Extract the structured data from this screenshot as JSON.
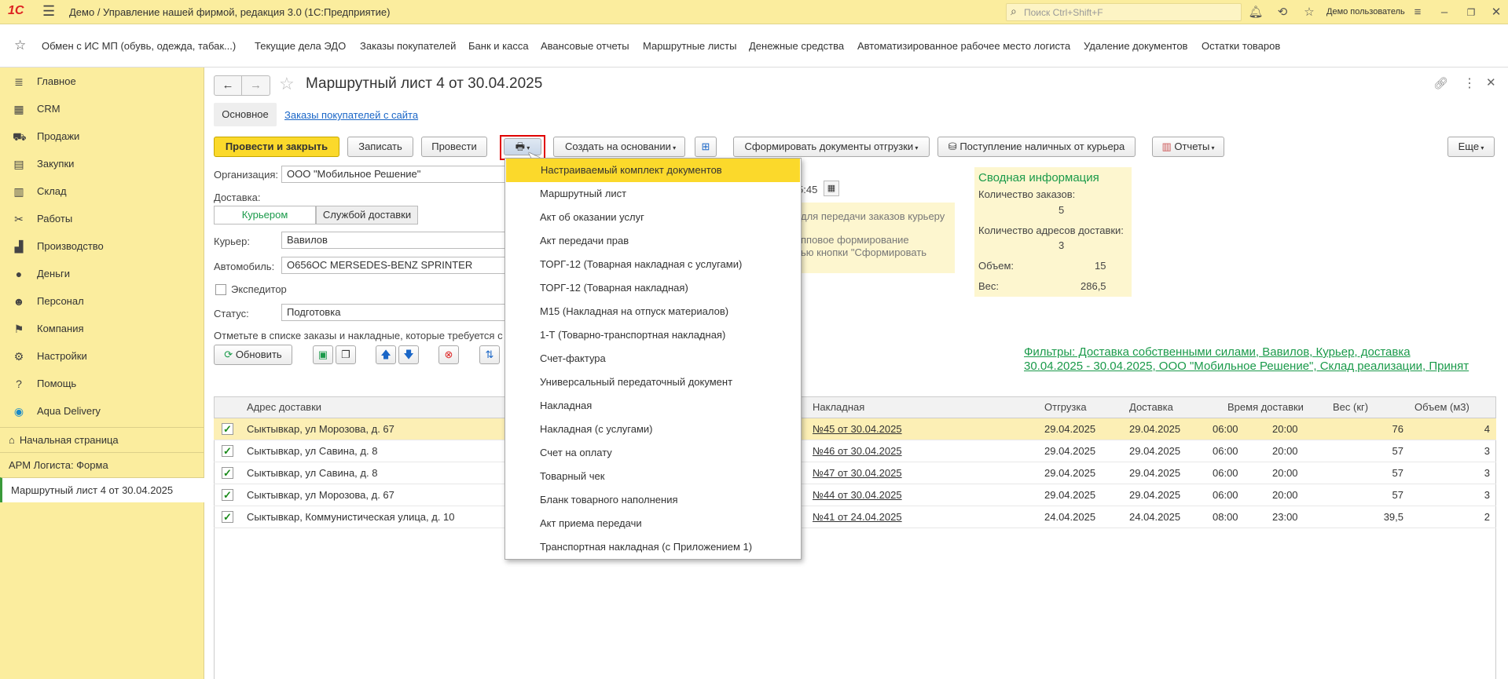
{
  "titlebar": {
    "logo": "1С",
    "title": "Демо / Управление нашей фирмой, редакция 3.0  (1С:Предприятие)",
    "search_placeholder": "Поиск Ctrl+Shift+F",
    "user": "Демо пользователь"
  },
  "favorites": [
    "Обмен с ИС МП (обувь, одежда, табак...)",
    "Текущие дела ЭДО",
    "Заказы покупателей",
    "Банк и касса",
    "Авансовые отчеты",
    "Маршрутные листы",
    "Денежные средства",
    "Автоматизированное рабочее место логиста",
    "Удаление документов",
    "Остатки товаров"
  ],
  "sidebar": {
    "items": [
      {
        "label": "Главное",
        "icon": "menu-lines-icon"
      },
      {
        "label": "CRM",
        "icon": "crm-icon"
      },
      {
        "label": "Продажи",
        "icon": "cart-icon"
      },
      {
        "label": "Закупки",
        "icon": "purchase-icon"
      },
      {
        "label": "Склад",
        "icon": "warehouse-icon"
      },
      {
        "label": "Работы",
        "icon": "tools-icon"
      },
      {
        "label": "Производство",
        "icon": "factory-icon"
      },
      {
        "label": "Деньги",
        "icon": "coin-icon"
      },
      {
        "label": "Персонал",
        "icon": "people-icon"
      },
      {
        "label": "Компания",
        "icon": "flag-icon"
      },
      {
        "label": "Настройки",
        "icon": "gear-icon"
      },
      {
        "label": "Помощь",
        "icon": "help-icon"
      },
      {
        "label": "Aqua Delivery",
        "icon": "drop-icon"
      }
    ],
    "open_windows": [
      "Начальная страница",
      "АРМ Логиста: Форма",
      "Маршрутный лист 4 от 30.04.2025"
    ]
  },
  "form": {
    "title": "Маршрутный лист 4 от 30.04.2025",
    "tabs": [
      "Основное",
      "Заказы покупателей с сайта"
    ],
    "toolbar": {
      "post_close": "Провести и закрыть",
      "save": "Записать",
      "post": "Провести",
      "create_based": "Создать на основании",
      "form_docs": "Сформировать документы отгрузки",
      "cash_receipt": "Поступление наличных от курьера",
      "reports": "Отчеты",
      "more": "Еще"
    },
    "org_label": "Организация:",
    "org_value": "ООО \"Мобильное Решение\"",
    "delivery_label": "Доставка:",
    "delivery_options": [
      "Курьером",
      "Службой доставки"
    ],
    "courier_label": "Курьер:",
    "courier_value": "Вавилов",
    "car_label": "Автомобиль:",
    "car_value": "О656ОС MERSEDES-BENZ SPRINTER",
    "forwarder_label": "Экспедитор",
    "status_label": "Статус:",
    "status_value": "Подготовка",
    "hint": "Отметьте в списке заказы и накладные, которые требуется с",
    "time_fragment": "5:45",
    "info_fragment": {
      "line1": "для передачи заказов курьеру",
      "line2": "пповое формирование",
      "line3": "ью кнопки \"Сформировать"
    },
    "refresh": "Обновить"
  },
  "summary": {
    "title": "Сводная информация",
    "orders_label": "Количество заказов:",
    "orders_value": "5",
    "addresses_label": "Количество адресов доставки:",
    "addresses_value": "3",
    "volume_label": "Объем:",
    "volume_value": "15",
    "weight_label": "Вес:",
    "weight_value": "286,5"
  },
  "filters_text": "Фильтры: Доставка собственными силами, Вавилов, Курьер, доставка 30.04.2025 - 30.04.2025, ООО \"Мобильное Решение\", Склад реализации, Принят",
  "table": {
    "headers": [
      "Адрес доставки",
      "Накладная",
      "Отгрузка",
      "Доставка",
      "Время доставки",
      "Вес (кг)",
      "Объем (м3)"
    ],
    "rows": [
      {
        "address": "Сыктывкар, ул Морозова, д. 67",
        "invoice": "№45 от 30.04.2025",
        "ship": "29.04.2025",
        "deliv": "29.04.2025",
        "from": "06:00",
        "to": "20:00",
        "weight": "76",
        "volume": "4"
      },
      {
        "address": "Сыктывкар, ул Савина, д. 8",
        "invoice": "№46 от 30.04.2025",
        "ship": "29.04.2025",
        "deliv": "29.04.2025",
        "from": "06:00",
        "to": "20:00",
        "weight": "57",
        "volume": "3"
      },
      {
        "address": "Сыктывкар, ул Савина, д. 8",
        "invoice": "№47 от 30.04.2025",
        "ship": "29.04.2025",
        "deliv": "29.04.2025",
        "from": "06:00",
        "to": "20:00",
        "weight": "57",
        "volume": "3"
      },
      {
        "address": "Сыктывкар, ул Морозова, д. 67",
        "invoice": "№44 от 30.04.2025",
        "ship": "29.04.2025",
        "deliv": "29.04.2025",
        "from": "06:00",
        "to": "20:00",
        "weight": "57",
        "volume": "3"
      },
      {
        "address": "Сыктывкар, Коммунистическая улица, д. 10",
        "invoice": "№41 от 24.04.2025",
        "ship": "24.04.2025",
        "deliv": "24.04.2025",
        "from": "08:00",
        "to": "23:00",
        "weight": "39,5",
        "volume": "2"
      }
    ]
  },
  "print_menu": [
    "Настраиваемый комплект документов",
    "Маршрутный лист",
    "Акт об оказании услуг",
    "Акт передачи прав",
    "ТОРГ-12 (Товарная накладная с услугами)",
    "ТОРГ-12 (Товарная накладная)",
    "М15 (Накладная на отпуск материалов)",
    "1-Т (Товарно-транспортная накладная)",
    "Счет-фактура",
    "Универсальный передаточный документ",
    "Накладная",
    "Накладная (с услугами)",
    "Счет на оплату",
    "Товарный чек",
    "Бланк товарного наполнения",
    "Акт приема передачи",
    "Транспортная накладная (с Приложением 1)"
  ],
  "colors": {
    "accent": "#fbd92b",
    "panel": "#fbed9e",
    "link": "#1a66c7",
    "green": "#1a9a4a",
    "highlight": "#e00000"
  }
}
